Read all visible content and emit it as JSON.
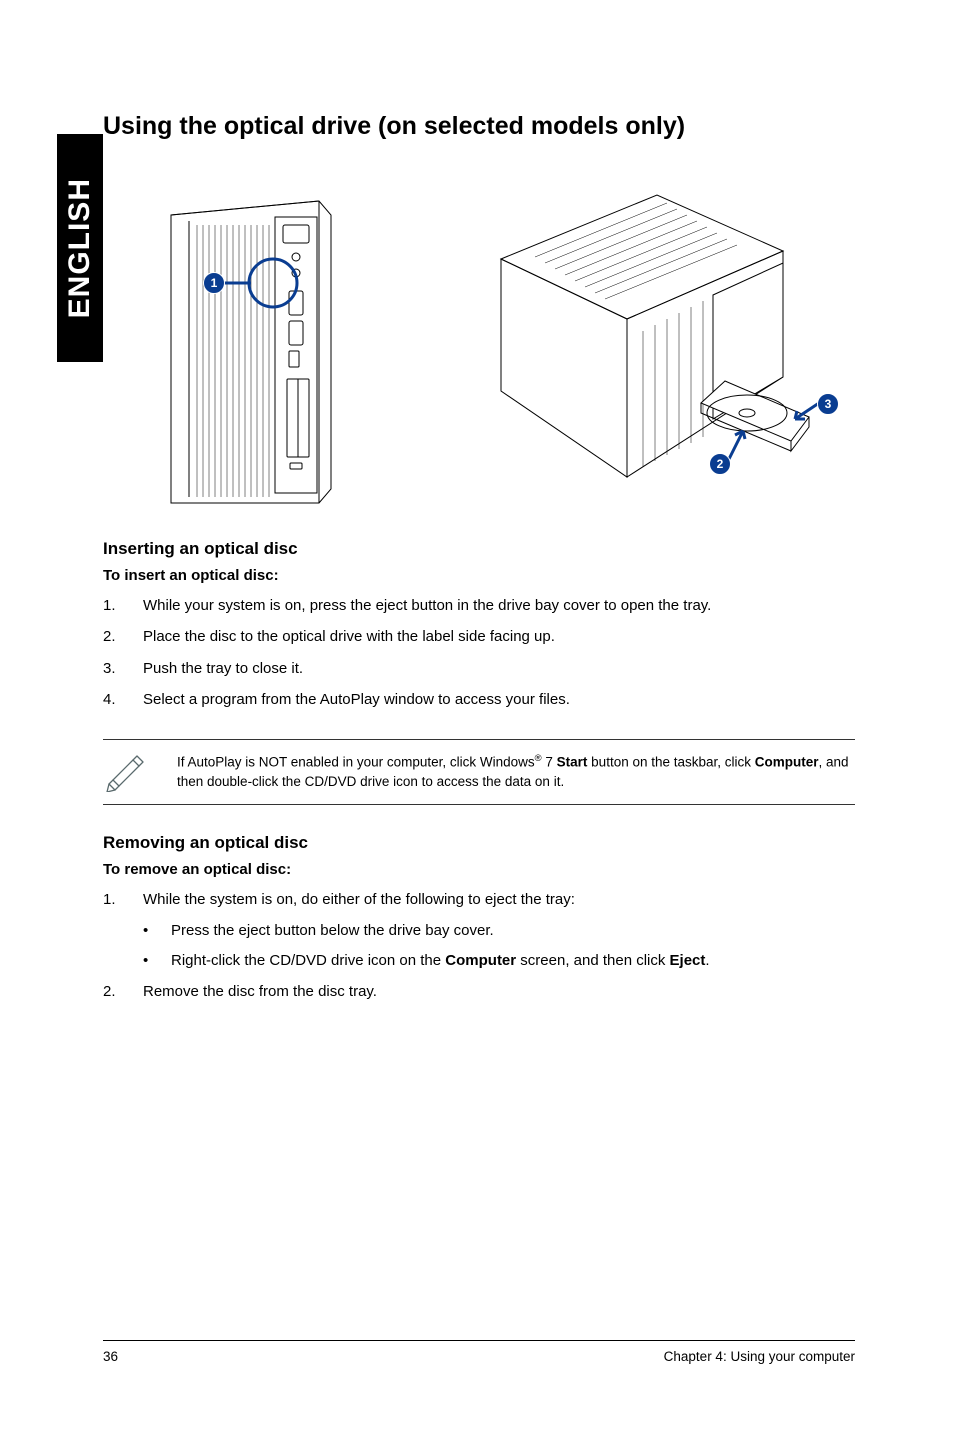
{
  "sidetab": "ENGLISH",
  "title": "Using the optical drive (on selected models only)",
  "callouts": {
    "c1": "1",
    "c2": "2",
    "c3": "3"
  },
  "insert": {
    "heading": "Inserting an optical disc",
    "sub": "To insert an optical disc:",
    "step1_num": "1.",
    "step1_txt": "While your system is on, press the eject button in the drive bay cover to open the tray.",
    "step2_num": "2.",
    "step2_txt": "Place the disc to the optical drive with the label side facing up.",
    "step3_num": "3.",
    "step3_txt": "Push the tray to close it.",
    "step4_num": "4.",
    "step4_txt": "Select a program from the AutoPlay window to access your files."
  },
  "note": {
    "pre": "If AutoPlay is NOT enabled in your computer, click Windows",
    "reg": "®",
    "mid": " 7 ",
    "bold1": "Start",
    "mid2": " button on the taskbar, click ",
    "bold2": "Computer",
    "post": ", and then double-click the CD/DVD drive icon to access the data on it."
  },
  "remove": {
    "heading": "Removing an optical disc",
    "sub": "To remove an optical disc:",
    "step1_num": "1.",
    "step1_txt": "While the system is on, do either of the following to eject the tray:",
    "b1": "Press the eject button below the drive bay cover.",
    "b2_pre": "Right-click the CD/DVD drive icon on the ",
    "b2_bold1": "Computer",
    "b2_mid": " screen, and then click ",
    "b2_bold2": "Eject",
    "b2_post": ".",
    "step2_num": "2.",
    "step2_txt": "Remove the disc from the disc tray."
  },
  "footer": {
    "page": "36",
    "chap": "Chapter 4: Using your computer"
  }
}
